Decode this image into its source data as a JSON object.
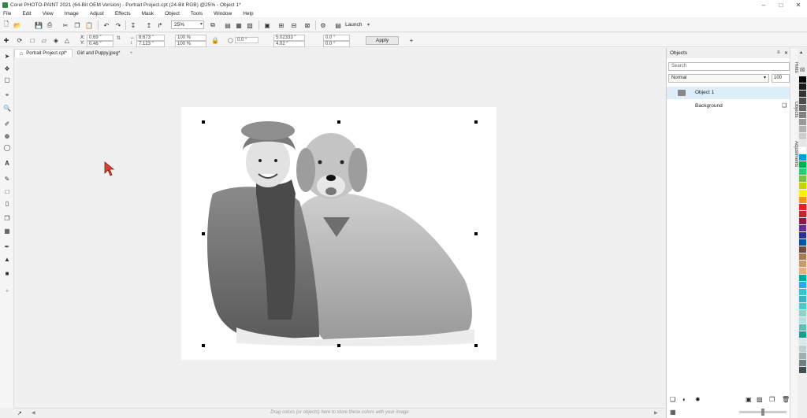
{
  "window": {
    "title": "Corel PHOTO-PAINT 2021 (64-Bit OEM Version) - Portrait Project.cpt (24-Bit RGB) @25% - Object 1*"
  },
  "menu": [
    "File",
    "Edit",
    "View",
    "Image",
    "Adjust",
    "Effects",
    "Mask",
    "Object",
    "Tools",
    "Window",
    "Help"
  ],
  "toolbar": {
    "zoom": "25%",
    "launch_label": "Launch"
  },
  "property_bar": {
    "x_label": "X:",
    "x_value": "0.69 \"",
    "y_label": "Y:",
    "y_value": "0.46 \"",
    "width_value": "8.673 \"",
    "height_value": "7.123 \"",
    "scale_x": "100 %",
    "scale_y": "100 %",
    "angle": "0.0 °",
    "skew_1": "5.02333 \"",
    "skew_2": "4.02 \"",
    "offset_1": "0.0 °",
    "offset_2": "0.0 °",
    "apply_label": "Apply"
  },
  "tabs": [
    {
      "label": "Portrait Project.cpt*"
    },
    {
      "label": "Girl and Puppy.jpeg*"
    }
  ],
  "objects_docker": {
    "title": "Objects",
    "search_placeholder": "Search",
    "blend_mode": "Normal",
    "opacity": "100",
    "layers": [
      {
        "name": "Object 1",
        "selected": true
      },
      {
        "name": "Background",
        "selected": false
      }
    ]
  },
  "side_tabs": [
    "Hints",
    "Objects",
    "Adjustments"
  ],
  "status": {
    "hint": "Drag colors (or objects) here to store these colors with your image"
  },
  "palette_colors": [
    "#000000",
    "#1a1a1a",
    "#333333",
    "#4d4d4d",
    "#666666",
    "#808080",
    "#999999",
    "#b3b3b3",
    "#cccccc",
    "#e6e6e6",
    "#ffffff",
    "#00a0e0",
    "#00b050",
    "#2ecc71",
    "#7ac143",
    "#c4d600",
    "#fff200",
    "#f7941d",
    "#ee1c25",
    "#c1272d",
    "#8b1a4a",
    "#662d91",
    "#2e3192",
    "#0054a6",
    "#6d4c41",
    "#a67c52",
    "#c69c6d",
    "#e6b27c",
    "#00a99d",
    "#29abe2",
    "#34c6cd",
    "#3bb3c3",
    "#4dc9c9",
    "#8dd3c7",
    "#b3e0e0",
    "#5fbfb3",
    "#1a9e8e",
    "#d9e9e9",
    "#c0d0d0",
    "#a0b0b0",
    "#708080",
    "#405050"
  ]
}
